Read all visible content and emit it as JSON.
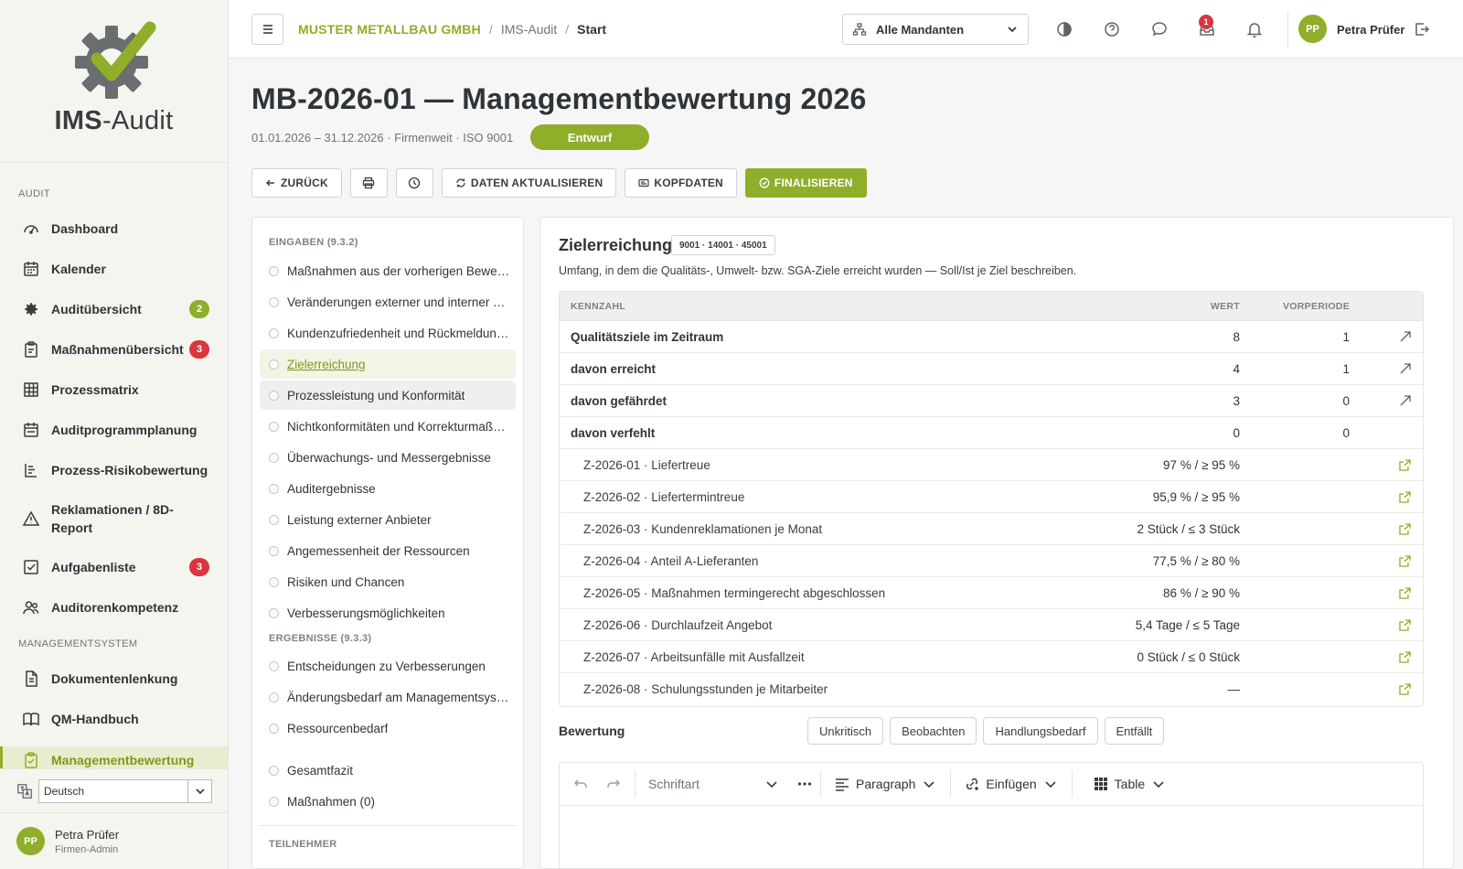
{
  "brand": {
    "logo_bold": "IMS",
    "logo_rest": "-Audit",
    "accent": "#8fae2a"
  },
  "sidebar": {
    "section_audit": "AUDIT",
    "section_mgmt": "MANAGEMENTSYSTEM",
    "items": [
      {
        "label": "Dashboard",
        "icon": "dashboard-icon"
      },
      {
        "label": "Kalender",
        "icon": "calendar-icon"
      },
      {
        "label": "Auditübersicht",
        "icon": "gear-icon",
        "badge": "2",
        "badge_color": "#8fae2a"
      },
      {
        "label": "Maßnahmenübersicht",
        "icon": "clipboard-icon",
        "badge": "3",
        "badge_color": "#d9363e"
      },
      {
        "label": "Prozessmatrix",
        "icon": "grid-icon"
      },
      {
        "label": "Auditprogrammplanung",
        "icon": "calendar-plan-icon"
      },
      {
        "label": "Prozess-Risikobewertung",
        "icon": "list-tree-icon"
      },
      {
        "label": "Reklamationen / 8D-Report",
        "icon": "warning-icon"
      },
      {
        "label": "Aufgabenliste",
        "icon": "checkbox-icon",
        "badge": "3",
        "badge_color": "#d9363e"
      },
      {
        "label": "Auditorenkompetenz",
        "icon": "users-icon"
      },
      {
        "label": "Dokumentenlenkung",
        "icon": "document-icon"
      },
      {
        "label": "QM-Handbuch",
        "icon": "book-icon"
      },
      {
        "label": "Managementbewertung",
        "icon": "clipboard-check-icon"
      }
    ],
    "language": "Deutsch",
    "user_name": "Petra Prüfer",
    "user_role": "Firmen-Admin",
    "user_initials": "PP"
  },
  "header": {
    "company": "MUSTER METALLBAU GMBH",
    "crumb_sep": "/",
    "crumb2": "IMS-Audit",
    "crumb3": "Start",
    "mandant": "Alle Mandanten",
    "notif_count": "1",
    "user_name": "Petra Prüfer",
    "user_initials": "PP"
  },
  "page": {
    "title": "MB-2026-01 — Managementbewertung 2026",
    "meta": "01.01.2026 – 31.12.2026 · Firmenweit · ISO 9001",
    "status": "Entwurf",
    "buttons": {
      "back": "ZURÜCK",
      "refresh": "DATEN AKTUALISIEREN",
      "header_data": "KOPFDATEN",
      "finalize": "FINALISIEREN"
    }
  },
  "inputs": {
    "section_in": "EINGABEN (9.3.2)",
    "section_out": "ERGEBNISSE (9.3.3)",
    "section_participants": "TEILNEHMER",
    "items_in": [
      "Maßnahmen aus der vorherigen Bewertung",
      "Veränderungen externer und interner Themen",
      "Kundenzufriedenheit und Rückmeldungen",
      "Zielerreichung",
      "Prozessleistung und Konformität",
      "Nichtkonformitäten und Korrekturmaßnahmen",
      "Überwachungs- und Messergebnisse",
      "Auditergebnisse",
      "Leistung externer Anbieter",
      "Angemessenheit der Ressourcen",
      "Risiken und Chancen",
      "Verbesserungsmöglichkeiten"
    ],
    "items_out": [
      "Entscheidungen zu Verbesserungen",
      "Änderungsbedarf am Managementsystem",
      "Ressourcenbedarf"
    ],
    "summary": "Gesamtfazit",
    "actions": "Maßnahmen (0)"
  },
  "detail": {
    "title": "Zielerreichung",
    "iso_tag": "9001 · 14001 · 45001",
    "description": "Umfang, in dem die Qualitäts-, Umwelt- bzw. SGA-Ziele erreicht wurden — Soll/Ist je Ziel beschreiben.",
    "table": {
      "headers": {
        "name": "KENNZAHL",
        "value": "WERT",
        "prev": "VORPERIODE"
      },
      "rows": [
        {
          "name": "Qualitätsziele im Zeitraum",
          "value": "8",
          "prev": "1",
          "main": true,
          "icon": "trend-up-icon"
        },
        {
          "name": "davon erreicht",
          "value": "4",
          "prev": "1",
          "main": true,
          "icon": "trend-up-icon"
        },
        {
          "name": "davon gefährdet",
          "value": "3",
          "prev": "0",
          "main": true,
          "icon": "trend-up-icon"
        },
        {
          "name": "davon verfehlt",
          "value": "0",
          "prev": "0",
          "main": true,
          "icon": ""
        },
        {
          "name": "Z-2026-01 · Liefertreue",
          "value": "97 % / ≥ 95 %",
          "prev": "",
          "main": false,
          "icon": "external-link-icon"
        },
        {
          "name": "Z-2026-02 · Liefertermintreue",
          "value": "95,9 % / ≥ 95 %",
          "prev": "",
          "main": false,
          "icon": "external-link-icon"
        },
        {
          "name": "Z-2026-03 · Kundenreklamationen je Monat",
          "value": "2 Stück / ≤ 3 Stück",
          "prev": "",
          "main": false,
          "icon": "external-link-icon"
        },
        {
          "name": "Z-2026-04 · Anteil A-Lieferanten",
          "value": "77,5 % / ≥ 80 %",
          "prev": "",
          "main": false,
          "icon": "external-link-icon"
        },
        {
          "name": "Z-2026-05 · Maßnahmen termingerecht abgeschlossen",
          "value": "86 % / ≥ 90 %",
          "prev": "",
          "main": false,
          "icon": "external-link-icon"
        },
        {
          "name": "Z-2026-06 · Durchlaufzeit Angebot",
          "value": "5,4 Tage / ≤ 5 Tage",
          "prev": "",
          "main": false,
          "icon": "external-link-icon"
        },
        {
          "name": "Z-2026-07 · Arbeitsunfälle mit Ausfallzeit",
          "value": "0 Stück / ≤ 0 Stück",
          "prev": "",
          "main": false,
          "icon": "external-link-icon"
        },
        {
          "name": "Z-2026-08 · Schulungsstunden je Mitarbeiter",
          "value": "—",
          "prev": "",
          "main": false,
          "icon": "external-link-icon"
        }
      ]
    },
    "rating_label": "Bewertung",
    "rating_options": [
      "Unkritisch",
      "Beobachten",
      "Handlungsbedarf",
      "Entfällt"
    ],
    "editor": {
      "font": "Schriftart",
      "paragraph": "Paragraph",
      "insert": "Einfügen",
      "table": "Table"
    }
  }
}
